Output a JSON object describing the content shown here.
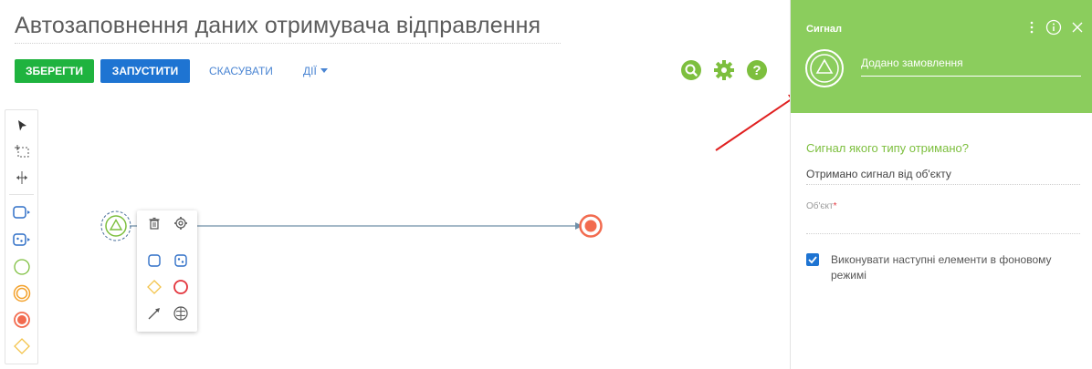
{
  "header": {
    "title": "Автозаповнення даних отримувача відправлення",
    "save_label": "ЗБЕРЕГТИ",
    "run_label": "ЗАПУСТИТИ",
    "cancel_label": "СКАСУВАТИ",
    "actions_label": "ДІЇ"
  },
  "colors": {
    "save": "#1fb33f",
    "run": "#1e74d2",
    "link": "#4a85d3",
    "panel_header": "#8bcd5d",
    "accent_green": "#7dbf3e",
    "end_event": "#f26b4f"
  },
  "toolbar": {
    "tools": [
      "pointer-icon",
      "lasso-select-icon",
      "space-tool-icon",
      "task-icon",
      "subprocess-icon",
      "start-event-icon",
      "intermediate-event-icon",
      "end-event-icon",
      "gateway-icon"
    ]
  },
  "panel": {
    "kind": "Сигнал",
    "name": "Додано замовлення",
    "question": "Сигнал якого типу отримано?",
    "signal_type": "Отримано сигнал від об'єкту",
    "object_label": "Об'єкт",
    "required_mark": "*",
    "background_checkbox_checked": true,
    "background_label": "Виконувати наступні елементи в фоновому режимі"
  }
}
